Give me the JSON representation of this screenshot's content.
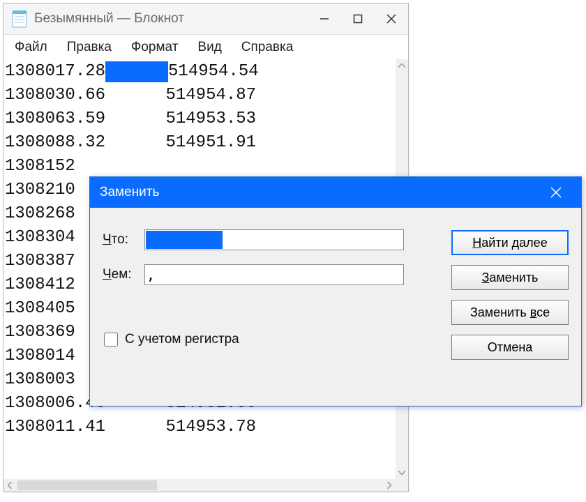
{
  "window": {
    "title": "Безымянный — Блокнот"
  },
  "menu": {
    "file": "Файл",
    "edit": "Правка",
    "format": "Формат",
    "view": "Вид",
    "help": "Справка"
  },
  "editor": {
    "lines": [
      {
        "a": "1308017.28",
        "gap": "      ",
        "b": "514954.54",
        "sel": true
      },
      {
        "a": "1308030.66",
        "gap": "      ",
        "b": "514954.87"
      },
      {
        "a": "1308063.59",
        "gap": "      ",
        "b": "514953.53"
      },
      {
        "a": "1308088.32",
        "gap": "      ",
        "b": "514951.91"
      },
      {
        "a": "1308152",
        "gap": "",
        "b": ""
      },
      {
        "a": "1308210",
        "gap": "",
        "b": ""
      },
      {
        "a": "1308268",
        "gap": "",
        "b": ""
      },
      {
        "a": "1308304",
        "gap": "",
        "b": ""
      },
      {
        "a": "1308387",
        "gap": "",
        "b": ""
      },
      {
        "a": "1308412",
        "gap": "",
        "b": ""
      },
      {
        "a": "1308405",
        "gap": "",
        "b": ""
      },
      {
        "a": "1308369",
        "gap": "",
        "b": ""
      },
      {
        "a": "1308014",
        "gap": "",
        "b": ""
      },
      {
        "a": "1308003",
        "gap": "",
        "b": ""
      },
      {
        "a": "1308006.46",
        "gap": "      ",
        "b": "514951.66"
      },
      {
        "a": "1308011.41",
        "gap": "      ",
        "b": "514953.78"
      }
    ]
  },
  "dialog": {
    "title": "Заменить",
    "what_prefix": "Ч",
    "what_rest": "то:",
    "what_value": "      ",
    "with_prefix": "Ч",
    "with_rest": "ем:",
    "with_value": ",",
    "case_label": "С учетом регистра",
    "case_ul": "р",
    "btn_find_prefix": "Н",
    "btn_find_rest": "айти далее",
    "btn_replace_prefix": "З",
    "btn_replace_rest": "аменить",
    "btn_replace_all_prefix": "Заменить ",
    "btn_replace_all_ul": "в",
    "btn_replace_all_rest": "се",
    "btn_cancel": "Отмена"
  }
}
